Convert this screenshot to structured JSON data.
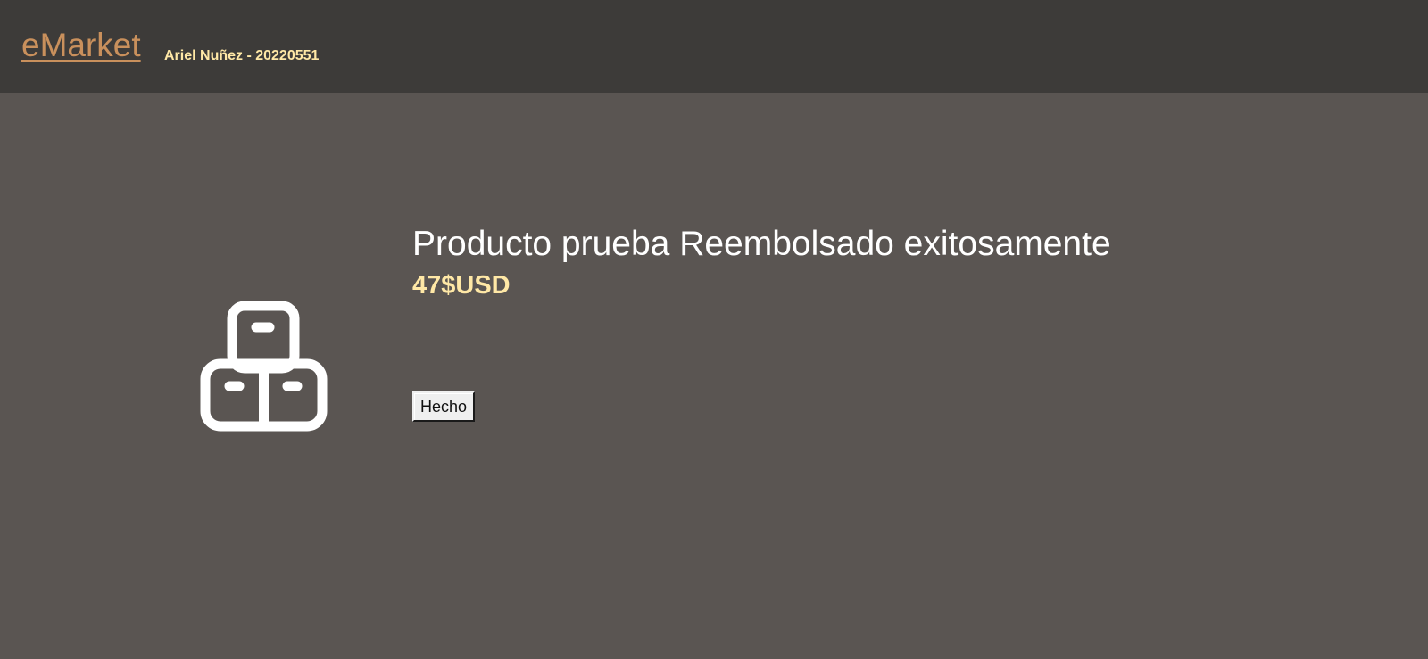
{
  "header": {
    "brand": "eMarket",
    "author": "Ariel Nuñez - 20220551"
  },
  "product": {
    "icon": "boxes-icon",
    "title": "Producto prueba Reembolsado exitosamente",
    "price": "47$USD"
  },
  "actions": {
    "done_label": "Hecho"
  },
  "colors": {
    "header_bg": "#3d3b39",
    "page_bg": "#5a5552",
    "brand": "#c9905c",
    "accent": "#ffe8a6",
    "text": "#ffffff"
  }
}
